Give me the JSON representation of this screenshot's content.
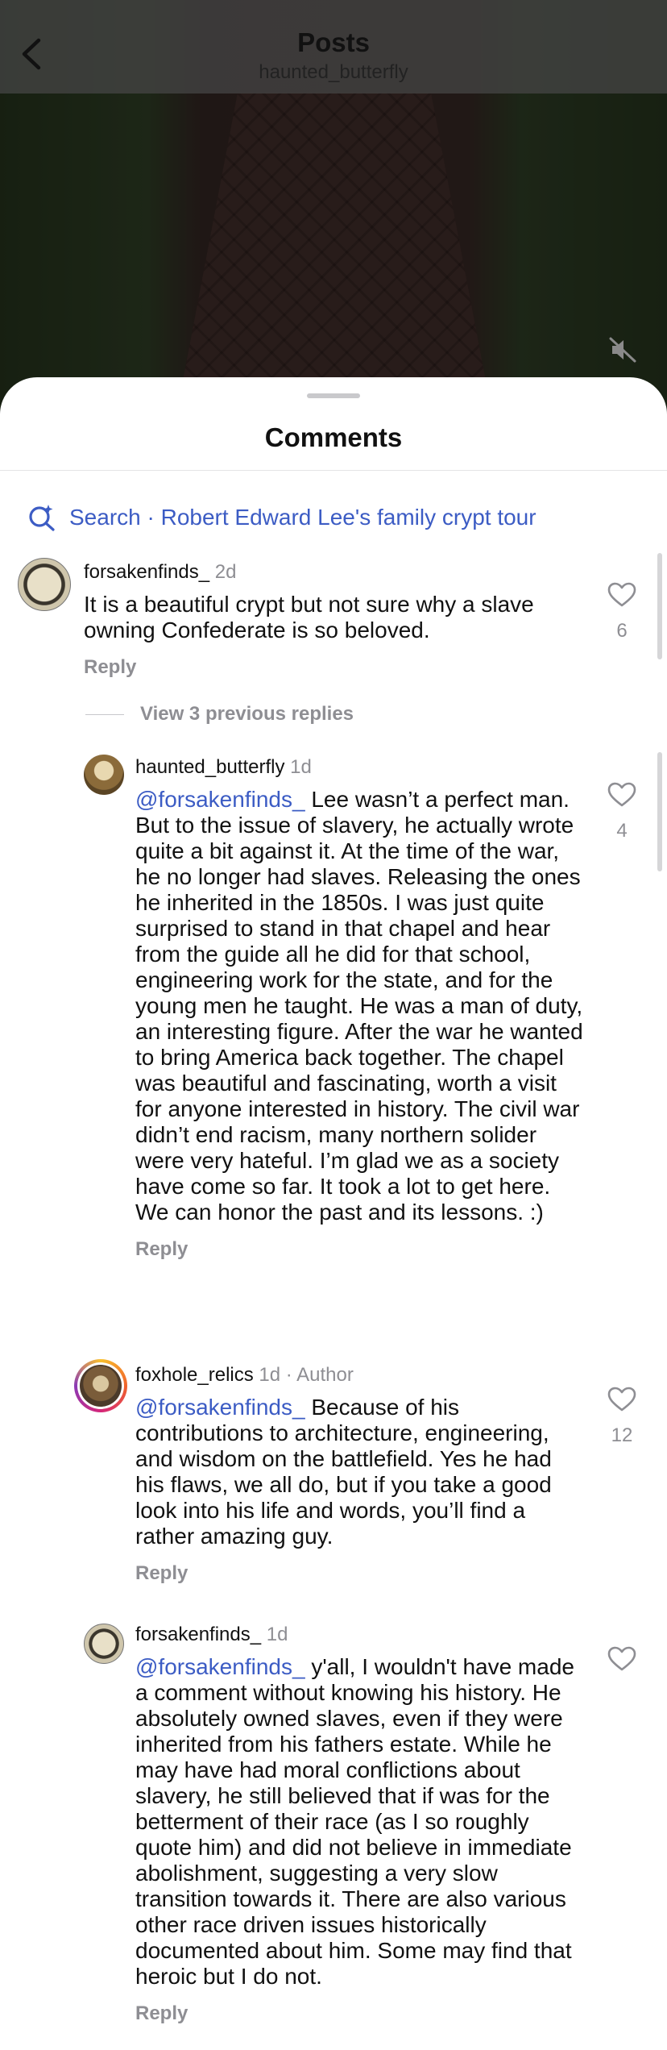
{
  "header": {
    "title": "Posts",
    "subtitle": "haunted_butterfly"
  },
  "sheet": {
    "title": "Comments",
    "search": "Search · Robert Edward Lee's family crypt tour"
  },
  "reply_label": "Reply",
  "view_replies": "View 3 previous replies",
  "comments": [
    {
      "username": "forsakenfinds_",
      "meta": "2d",
      "text": "It is a beautiful crypt but not sure why a slave owning Confederate is so beloved.",
      "likes": "6"
    },
    {
      "username": "haunted_butterfly",
      "meta": "1d",
      "mention": "@forsakenfinds_",
      "text": " Lee wasn’t a perfect man. But to the issue of slavery, he actually wrote quite a bit against it. At the time of the war, he no longer had slaves. Releasing the ones he inherited in the 1850s. I was just quite surprised to stand in that chapel and hear from the guide all he did for that school, engineering work for the state, and for the young men he taught. He was a man of duty, an interesting figure. After the war he wanted to bring America back together. The chapel was beautiful and fascinating, worth a visit for anyone interested in history. The civil war didn’t end racism, many northern solider were very hateful. I’m glad we as a society have come so far. It took a lot to get here. We can honor the past and its lessons. :)",
      "likes": "4"
    },
    {
      "username": "foxhole_relics",
      "meta": "1d · Author",
      "mention": "@forsakenfinds_",
      "text": " Because of his contributions to architecture, engineering, and wisdom on the battlefield. Yes he had his flaws, we all do, but if you take a good look into his life and words, you’ll find a rather amazing guy.",
      "likes": "12"
    },
    {
      "username": "forsakenfinds_",
      "meta": "1d",
      "mention": "@forsakenfinds_",
      "text": " y'all, I wouldn't have made a comment without knowing his history. He absolutely owned slaves, even if they were inherited from his fathers estate. While he may have had moral conflictions about slavery, he still believed that if was for the betterment of their race (as I so roughly quote him)  and did not believe in immediate abolishment, suggesting a very slow transition towards it. There are also various other race driven issues historically documented about him. Some may find that heroic but I do not."
    }
  ],
  "icons": {
    "back": "chevron-left-icon",
    "mute": "speaker-muted-icon",
    "search": "sparkle-search-icon",
    "like": "heart-outline-icon"
  },
  "colors": {
    "accent": "#3c5cc4",
    "secondary_text": "#8e8e93"
  }
}
